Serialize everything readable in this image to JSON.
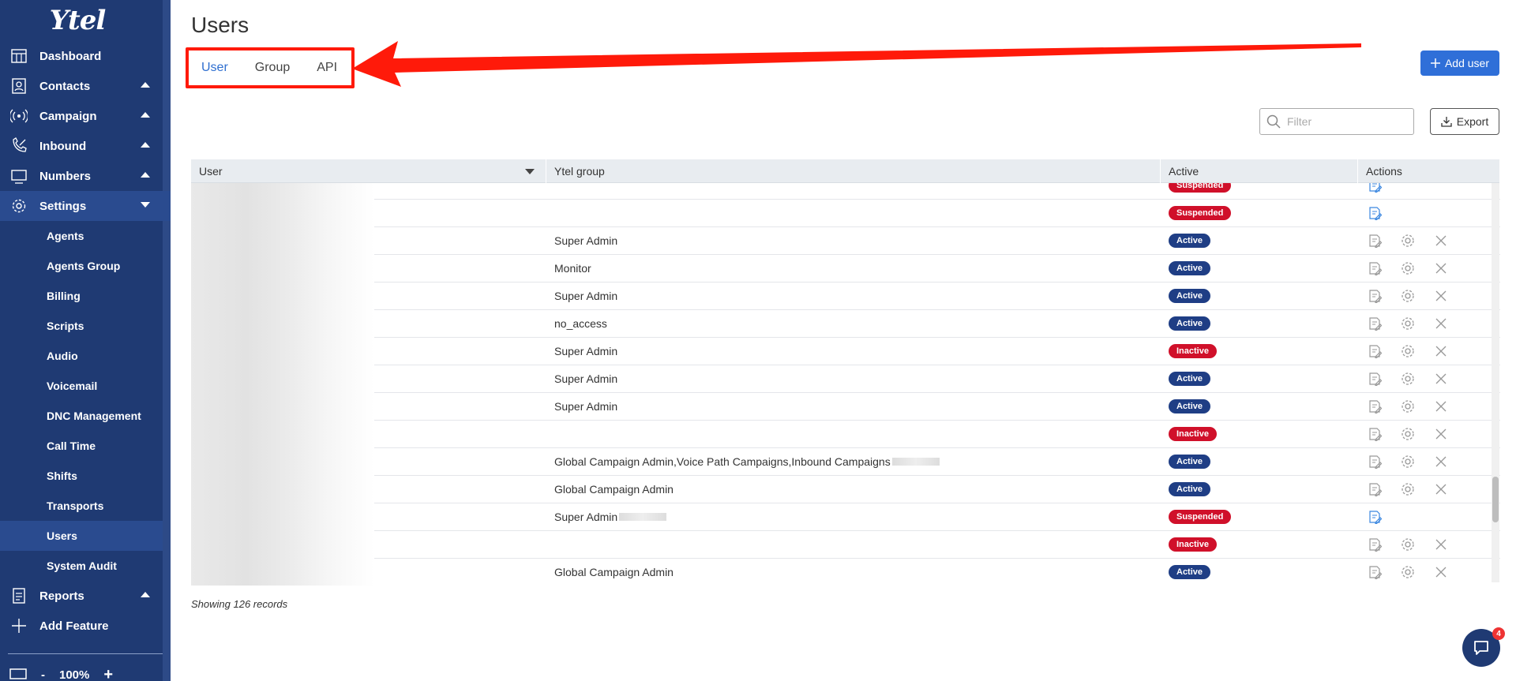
{
  "sidebar": {
    "logo": "Ytel",
    "nav": [
      {
        "label": "Dashboard",
        "icon": "dashboard-icon",
        "caret": ""
      },
      {
        "label": "Contacts",
        "icon": "contacts-icon",
        "caret": "up"
      },
      {
        "label": "Campaign",
        "icon": "campaign-icon",
        "caret": "up"
      },
      {
        "label": "Inbound",
        "icon": "inbound-icon",
        "caret": "up"
      },
      {
        "label": "Numbers",
        "icon": "numbers-icon",
        "caret": "up"
      },
      {
        "label": "Settings",
        "icon": "gear-icon",
        "caret": "down"
      }
    ],
    "settings_items": [
      "Agents",
      "Agents Group",
      "Billing",
      "Scripts",
      "Audio",
      "Voicemail",
      "DNC Management",
      "Call Time",
      "Shifts",
      "Transports",
      "Users",
      "System Audit"
    ],
    "selected_item": "Users",
    "after": [
      {
        "label": "Reports",
        "icon": "reports-icon",
        "caret": "up"
      },
      {
        "label": "Add Feature",
        "icon": "plus-icon",
        "caret": ""
      }
    ],
    "zoom": {
      "minus": "-",
      "value": "100%",
      "plus": "+"
    }
  },
  "main": {
    "title": "Users",
    "tabs": [
      {
        "label": "User",
        "active": true
      },
      {
        "label": "Group",
        "active": false
      },
      {
        "label": "API",
        "active": false
      }
    ],
    "add_user_label": "Add user",
    "filter_placeholder": "Filter",
    "export_label": "Export",
    "table": {
      "columns": [
        "User",
        "Ytel group",
        "Active",
        "Actions"
      ],
      "rows": [
        {
          "group": "",
          "status": "Suspended",
          "actions": "edit"
        },
        {
          "group": "",
          "status": "Suspended",
          "actions": "edit"
        },
        {
          "group": "Super Admin",
          "status": "Active",
          "actions": "all"
        },
        {
          "group": "Monitor",
          "status": "Active",
          "actions": "all"
        },
        {
          "group": "Super Admin",
          "status": "Active",
          "actions": "all"
        },
        {
          "group": "no_access",
          "status": "Active",
          "actions": "all"
        },
        {
          "group": "Super Admin",
          "status": "Inactive",
          "actions": "all"
        },
        {
          "group": "Super Admin",
          "status": "Active",
          "actions": "all"
        },
        {
          "group": "Super Admin",
          "status": "Active",
          "actions": "all"
        },
        {
          "group": "",
          "status": "Inactive",
          "actions": "all"
        },
        {
          "group": "Global Campaign Admin,Voice Path Campaigns,Inbound Campaigns",
          "status": "Active",
          "actions": "all",
          "blur_tail": true
        },
        {
          "group": "Global Campaign Admin",
          "status": "Active",
          "actions": "all"
        },
        {
          "group": "Super Admin",
          "status": "Suspended",
          "actions": "edit",
          "blur_tail": true
        },
        {
          "group": "",
          "status": "Inactive",
          "actions": "all"
        },
        {
          "group": "Global Campaign Admin",
          "status": "Active",
          "actions": "all"
        }
      ]
    },
    "records_text": "Showing 126 records",
    "chat_badge": "4"
  },
  "colors": {
    "sidebar": "#1f3a73",
    "accent": "#2f6fd8",
    "active_badge": "#1f3e85",
    "inactive_badge": "#d0102a",
    "annotation": "#ff1a0a"
  }
}
